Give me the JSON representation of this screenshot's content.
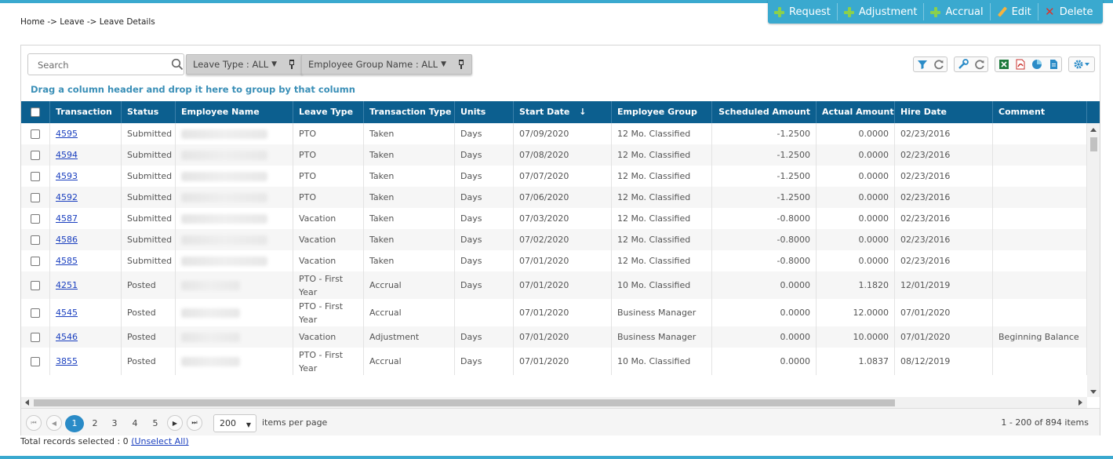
{
  "breadcrumb": "Home -> Leave -> Leave Details",
  "actions": {
    "request": "Request",
    "adjustment": "Adjustment",
    "accrual": "Accrual",
    "edit": "Edit",
    "delete": "Delete"
  },
  "search": {
    "placeholder": "Search"
  },
  "filters": {
    "leave_type": "Leave Type : ALL",
    "employee_group": "Employee Group Name : ALL"
  },
  "group_hint": "Drag a column header and drop it here to group by that column",
  "columns": {
    "transaction": "Transaction",
    "status": "Status",
    "employee_name": "Employee Name",
    "leave_type": "Leave Type",
    "transaction_type": "Transaction Type",
    "units": "Units",
    "start_date": "Start Date",
    "start_date_sort": "↓",
    "employee_group": "Employee Group",
    "scheduled_amount": "Scheduled Amount",
    "actual_amount": "Actual Amount",
    "hire_date": "Hire Date",
    "comment": "Comment"
  },
  "rows": [
    {
      "transaction": "4595",
      "status": "Submitted",
      "leave_type": "PTO",
      "transaction_type": "Taken",
      "units": "Days",
      "start_date": "07/09/2020",
      "employee_group": "12 Mo. Classified",
      "scheduled_amount": "-1.2500",
      "actual_amount": "0.0000",
      "hire_date": "02/23/2016",
      "comment": ""
    },
    {
      "transaction": "4594",
      "status": "Submitted",
      "leave_type": "PTO",
      "transaction_type": "Taken",
      "units": "Days",
      "start_date": "07/08/2020",
      "employee_group": "12 Mo. Classified",
      "scheduled_amount": "-1.2500",
      "actual_amount": "0.0000",
      "hire_date": "02/23/2016",
      "comment": ""
    },
    {
      "transaction": "4593",
      "status": "Submitted",
      "leave_type": "PTO",
      "transaction_type": "Taken",
      "units": "Days",
      "start_date": "07/07/2020",
      "employee_group": "12 Mo. Classified",
      "scheduled_amount": "-1.2500",
      "actual_amount": "0.0000",
      "hire_date": "02/23/2016",
      "comment": ""
    },
    {
      "transaction": "4592",
      "status": "Submitted",
      "leave_type": "PTO",
      "transaction_type": "Taken",
      "units": "Days",
      "start_date": "07/06/2020",
      "employee_group": "12 Mo. Classified",
      "scheduled_amount": "-1.2500",
      "actual_amount": "0.0000",
      "hire_date": "02/23/2016",
      "comment": ""
    },
    {
      "transaction": "4587",
      "status": "Submitted",
      "leave_type": "Vacation",
      "transaction_type": "Taken",
      "units": "Days",
      "start_date": "07/03/2020",
      "employee_group": "12 Mo. Classified",
      "scheduled_amount": "-0.8000",
      "actual_amount": "0.0000",
      "hire_date": "02/23/2016",
      "comment": ""
    },
    {
      "transaction": "4586",
      "status": "Submitted",
      "leave_type": "Vacation",
      "transaction_type": "Taken",
      "units": "Days",
      "start_date": "07/02/2020",
      "employee_group": "12 Mo. Classified",
      "scheduled_amount": "-0.8000",
      "actual_amount": "0.0000",
      "hire_date": "02/23/2016",
      "comment": ""
    },
    {
      "transaction": "4585",
      "status": "Submitted",
      "leave_type": "Vacation",
      "transaction_type": "Taken",
      "units": "Days",
      "start_date": "07/01/2020",
      "employee_group": "12 Mo. Classified",
      "scheduled_amount": "-0.8000",
      "actual_amount": "0.0000",
      "hire_date": "02/23/2016",
      "comment": ""
    },
    {
      "transaction": "4251",
      "status": "Posted",
      "leave_type": "PTO - First Year",
      "transaction_type": "Accrual",
      "units": "Days",
      "start_date": "07/01/2020",
      "employee_group": "10 Mo. Classified",
      "scheduled_amount": "0.0000",
      "actual_amount": "1.1820",
      "hire_date": "12/01/2019",
      "comment": ""
    },
    {
      "transaction": "4545",
      "status": "Posted",
      "leave_type": "PTO - First Year",
      "transaction_type": "Accrual",
      "units": "",
      "start_date": "07/01/2020",
      "employee_group": "Business Manager",
      "scheduled_amount": "0.0000",
      "actual_amount": "12.0000",
      "hire_date": "07/01/2020",
      "comment": ""
    },
    {
      "transaction": "4546",
      "status": "Posted",
      "leave_type": "Vacation",
      "transaction_type": "Adjustment",
      "units": "Days",
      "start_date": "07/01/2020",
      "employee_group": "Business Manager",
      "scheduled_amount": "0.0000",
      "actual_amount": "10.0000",
      "hire_date": "07/01/2020",
      "comment": "Beginning Balance"
    },
    {
      "transaction": "3855",
      "status": "Posted",
      "leave_type": "PTO - First Year",
      "transaction_type": "Accrual",
      "units": "Days",
      "start_date": "07/01/2020",
      "employee_group": "10 Mo. Classified",
      "scheduled_amount": "0.0000",
      "actual_amount": "1.0837",
      "hire_date": "08/12/2019",
      "comment": ""
    }
  ],
  "pager": {
    "pages": [
      "1",
      "2",
      "3",
      "4",
      "5"
    ],
    "active_page": "1",
    "per_page": "200",
    "per_page_label": "items per page",
    "range": "1 - 200 of 894 items"
  },
  "selection": {
    "label": "Total records selected : 0",
    "unselect": "(Unselect All)"
  },
  "colors": {
    "accent": "#3aa9cf",
    "header": "#0c5f8f",
    "link": "#1a3fbf"
  }
}
